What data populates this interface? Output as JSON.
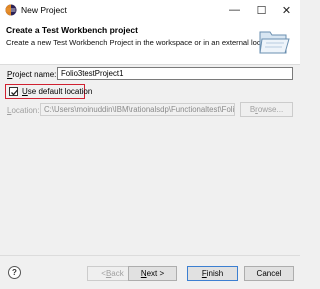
{
  "window": {
    "title": "New Project"
  },
  "title_buttons": {
    "minimize": "—",
    "maximize": "☐",
    "close": "✕"
  },
  "banner": {
    "title": "Create a Test Workbench project",
    "subtitle": "Create a new Test Workbench Project in the workspace or in an external location."
  },
  "form": {
    "project_name_label_u": "P",
    "project_name_label_rest": "roject name:",
    "project_name_value": "Folio3testProject1",
    "use_default_u": "U",
    "use_default_rest": "se default location",
    "use_default_checked": true,
    "location_label_u": "L",
    "location_label_rest": "ocation:",
    "location_value": "C:\\Users\\moinuddin\\IBM\\rationalsdp\\Functionaltest\\Folio3te",
    "browse_label_u": "r",
    "browse_label_pre": "B",
    "browse_label_post": "owse..."
  },
  "footer": {
    "help_icon": "?",
    "back_pre": "< ",
    "back_u": "B",
    "back_post": "ack",
    "next_u": "N",
    "next_post": "ext >",
    "finish_u": "F",
    "finish_post": "inish",
    "cancel": "Cancel"
  },
  "colors": {
    "highlight_border": "#d02030",
    "default_button_border": "#3c7fd1"
  }
}
